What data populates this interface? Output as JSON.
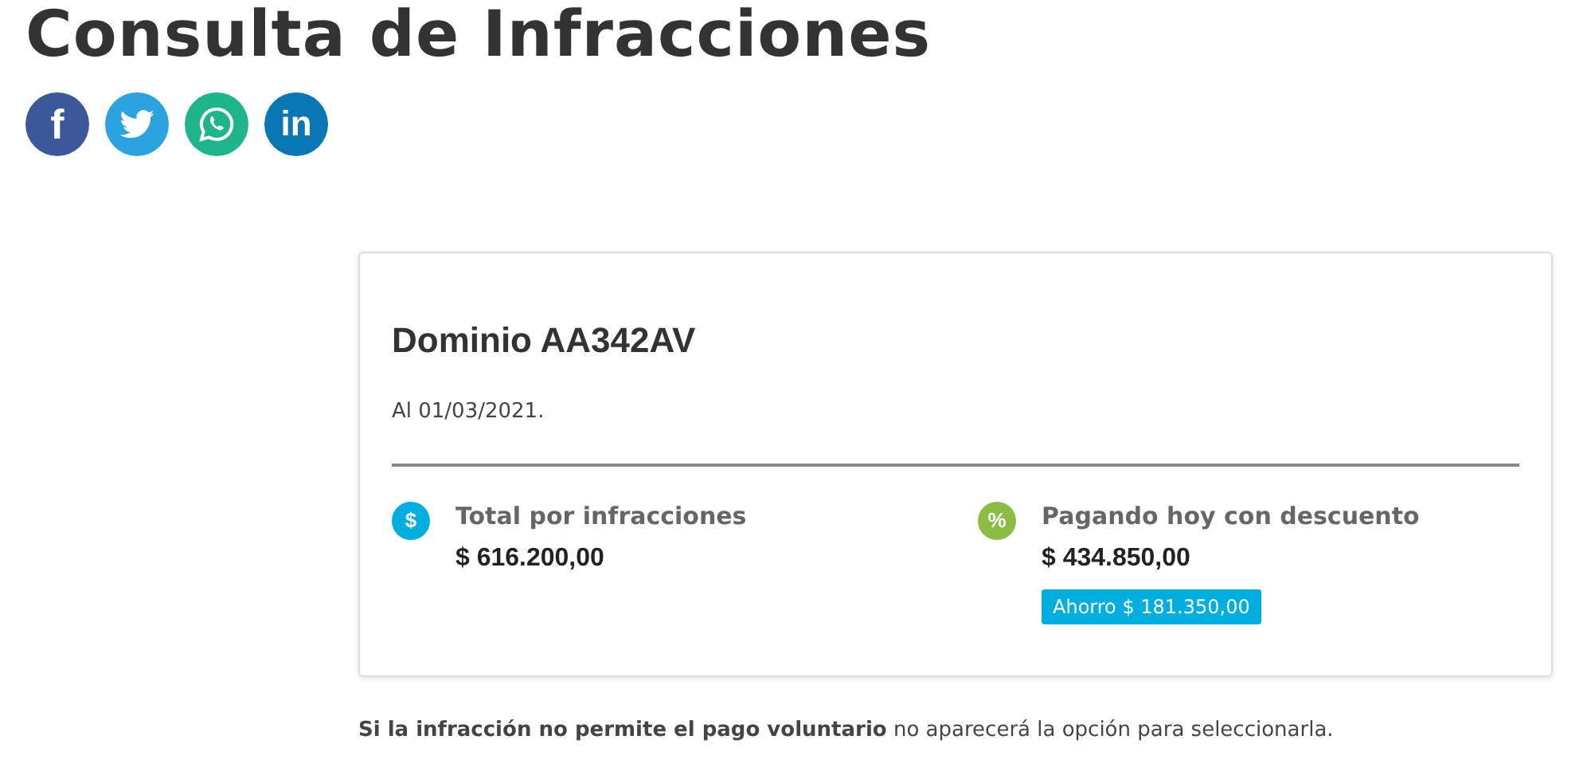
{
  "page": {
    "title": "Consulta de Infracciones"
  },
  "share": [
    {
      "kind": "facebook",
      "glyph": "f"
    },
    {
      "kind": "twitter"
    },
    {
      "kind": "whatsapp"
    },
    {
      "kind": "linkedin",
      "glyph": "in"
    }
  ],
  "card": {
    "title": "Dominio AA342AV",
    "date": "Al 01/03/2021.",
    "summary": [
      {
        "kind": "total",
        "icon": "$",
        "label": "Total por infracciones",
        "amount": "$ 616.200,00"
      },
      {
        "kind": "discount",
        "icon": "%",
        "label": "Pagando hoy con descuento",
        "amount": "$ 434.850,00",
        "savings": "Ahorro $ 181.350,00"
      }
    ]
  },
  "note": "**Si la infracción no permite el pago voluntario** no aparecerá la opción para seleccionarla."
}
